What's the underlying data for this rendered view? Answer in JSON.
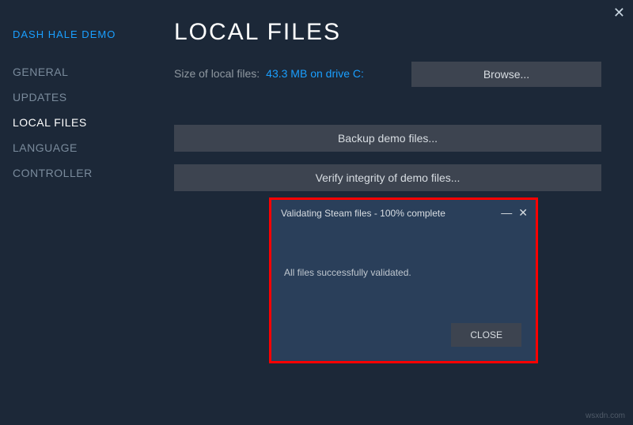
{
  "closeX": "✕",
  "sidebar": {
    "game": "DASH HALE DEMO",
    "items": [
      {
        "label": "GENERAL"
      },
      {
        "label": "UPDATES"
      },
      {
        "label": "LOCAL FILES"
      },
      {
        "label": "LANGUAGE"
      },
      {
        "label": "CONTROLLER"
      }
    ]
  },
  "main": {
    "title": "LOCAL FILES",
    "sizeLabel": "Size of local files:",
    "sizeValue": "43.3 MB on drive C:",
    "browse": "Browse...",
    "backup": "Backup demo files...",
    "verify": "Verify integrity of demo files..."
  },
  "dialog": {
    "title": "Validating Steam files - 100% complete",
    "minimize": "—",
    "close": "✕",
    "message": "All files successfully validated.",
    "closeBtn": "CLOSE"
  },
  "watermark": "wsxdn.com"
}
